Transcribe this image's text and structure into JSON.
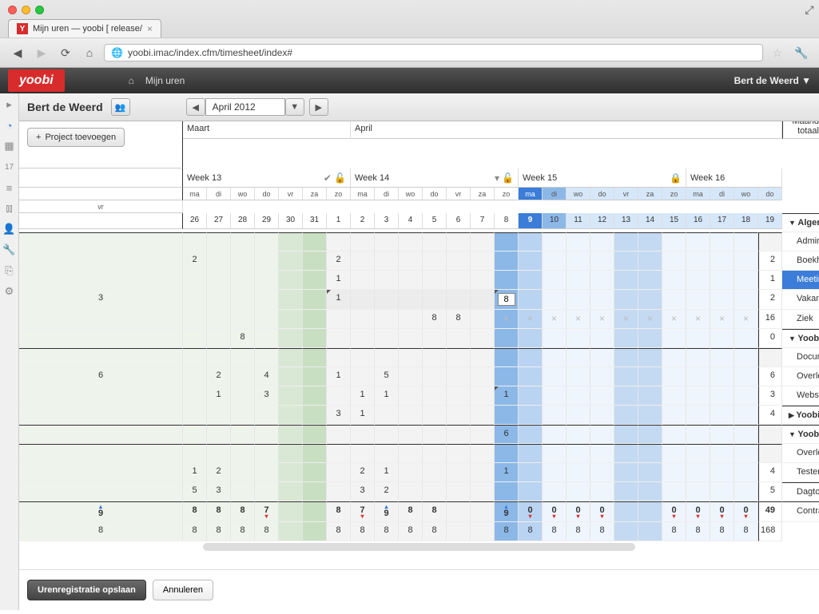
{
  "browser": {
    "tab_title": "Mijn uren — yoobi [ release/",
    "url": "yoobi.imac/index.cfm/timesheet/index#"
  },
  "app": {
    "logo": "yoobi",
    "breadcrumb": "Mijn uren",
    "user": "Bert de Weerd ▼"
  },
  "header": {
    "person": "Bert de Weerd",
    "month": "April 2012",
    "add_project": "Project toevoegen"
  },
  "months": {
    "m1": "Maart",
    "m2": "April"
  },
  "weeks": {
    "w13": "Week 13",
    "w14": "Week 14",
    "w15": "Week 15",
    "w16": "Week 16"
  },
  "days": [
    "ma",
    "di",
    "wo",
    "do",
    "vr",
    "za",
    "zo",
    "ma",
    "di",
    "wo",
    "do",
    "vr",
    "za",
    "zo",
    "ma",
    "di",
    "wo",
    "do",
    "vr",
    "za",
    "zo",
    "ma",
    "di",
    "wo",
    "do",
    "vr"
  ],
  "dates": [
    "26",
    "27",
    "28",
    "29",
    "30",
    "31",
    "1",
    "2",
    "3",
    "4",
    "5",
    "6",
    "7",
    "8",
    "9",
    "10",
    "11",
    "12",
    "13",
    "14",
    "15",
    "16",
    "17",
    "18",
    "19"
  ],
  "maand_label": "Maand totaal",
  "groups": {
    "g1": "Algemeen",
    "g2": "Yoobi - Marketing",
    "g3": "Yoobi - Planning",
    "g4": "Yoobi - Support"
  },
  "rows": {
    "admin": {
      "label": "Administratie",
      "vals": {
        "1": "2",
        "7": "2"
      },
      "total": "2"
    },
    "boek": {
      "label": "Boekhouding",
      "vals": {
        "7": "1"
      },
      "total": "1"
    },
    "meeting": {
      "label": "Meeting",
      "vals": {
        "0": "3",
        "7": "1",
        "14": "8"
      },
      "total": "2"
    },
    "vakantie": {
      "label": "Vakantie",
      "vals": {
        "11": "8",
        "12": "8"
      },
      "total": "16",
      "locked_from": 14
    },
    "ziek": {
      "label": "Ziek",
      "vals": {
        "3": "8"
      },
      "total": "0"
    },
    "doc": {
      "label": "Documentatie, folders",
      "vals": {
        "0": "6",
        "2": "2",
        "4": "4",
        "7": "1",
        "9": "5"
      },
      "total": "6"
    },
    "overlegc": {
      "label": "Overleg en communicatie",
      "vals": {
        "2": "1",
        "4": "3",
        "8": "1",
        "9": "1",
        "14": "1"
      },
      "total": "3"
    },
    "website": {
      "label": "Website",
      "vals": {
        "7": "3",
        "8": "1"
      },
      "total": "4"
    },
    "planning": {
      "label": "",
      "vals": {
        "14": "6"
      },
      "total": ""
    },
    "overleg": {
      "label": "Overleg",
      "vals": {
        "1": "1",
        "2": "2",
        "8": "2",
        "9": "1",
        "14": "1"
      },
      "total": "4"
    },
    "testen": {
      "label": "Testen",
      "vals": {
        "1": "5",
        "2": "3",
        "8": "3",
        "9": "2"
      },
      "total": "5"
    }
  },
  "dagtotaal": {
    "label": "Dagtotaal",
    "vals": [
      "9",
      "8",
      "8",
      "8",
      "7",
      "",
      "",
      "8",
      "7",
      "9",
      "8",
      "8",
      "",
      "",
      "9",
      "0",
      "0",
      "0",
      "0",
      "",
      "",
      "0",
      "0",
      "0",
      "0"
    ],
    "marks": [
      "up",
      "",
      "",
      "",
      "dn",
      "",
      "",
      "",
      "dn",
      "up",
      "",
      "",
      "",
      "",
      "up",
      "dn",
      "dn",
      "dn",
      "dn",
      "",
      "",
      "dn",
      "dn",
      "dn",
      "dn"
    ],
    "total": "49"
  },
  "contract": {
    "label": "Contract",
    "vals": [
      "8",
      "8",
      "8",
      "8",
      "8",
      "",
      "",
      "8",
      "8",
      "8",
      "8",
      "8",
      "",
      "",
      "8",
      "8",
      "8",
      "8",
      "8",
      "",
      "",
      "8",
      "8",
      "8",
      "8"
    ],
    "total": "168"
  },
  "buttons": {
    "save": "Urenregistratie opslaan",
    "cancel": "Annuleren"
  }
}
